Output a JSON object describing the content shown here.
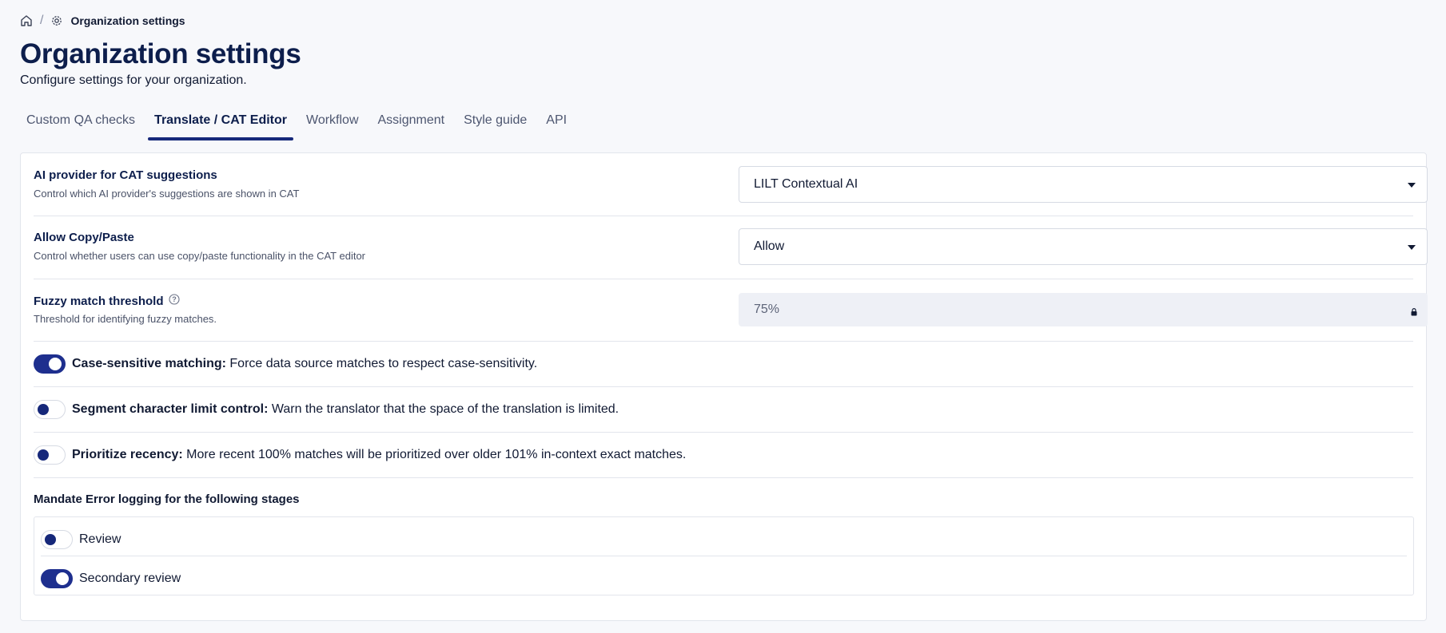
{
  "breadcrumb": {
    "home_icon": "home-icon",
    "separator": "/",
    "settings_icon": "gear-icon",
    "current": "Organization settings"
  },
  "page": {
    "title": "Organization settings",
    "subtitle": "Configure settings for your organization."
  },
  "tabs": [
    {
      "label": "Custom QA checks",
      "active": false
    },
    {
      "label": "Translate / CAT Editor",
      "active": true
    },
    {
      "label": "Workflow",
      "active": false
    },
    {
      "label": "Assignment",
      "active": false
    },
    {
      "label": "Style guide",
      "active": false
    },
    {
      "label": "API",
      "active": false
    }
  ],
  "settings": {
    "ai_provider": {
      "title": "AI provider for CAT suggestions",
      "description": "Control which AI provider's suggestions are shown in CAT",
      "value": "LILT Contextual AI"
    },
    "copy_paste": {
      "title": "Allow Copy/Paste",
      "description": "Control whether users can use copy/paste functionality in the CAT editor",
      "value": "Allow"
    },
    "fuzzy_match": {
      "title": "Fuzzy match threshold",
      "description": "Threshold for identifying fuzzy matches.",
      "value": "75%",
      "locked": true
    }
  },
  "toggles": [
    {
      "label": "Case-sensitive matching:",
      "text": " Force data source matches to respect case-sensitivity.",
      "on": true
    },
    {
      "label": "Segment character limit control:",
      "text": " Warn the translator that the space of the translation is limited.",
      "on": false
    },
    {
      "label": "Prioritize recency:",
      "text": " More recent 100% matches will be prioritized over older 101% in-context exact matches.",
      "on": false
    }
  ],
  "error_logging": {
    "title": "Mandate Error logging for the following stages",
    "stages": [
      {
        "label": "Review",
        "on": false
      },
      {
        "label": "Secondary review",
        "on": true
      }
    ]
  },
  "colors": {
    "accent": "#1e2f8e",
    "title": "#0d1e4c",
    "background": "#f7f8fb"
  }
}
